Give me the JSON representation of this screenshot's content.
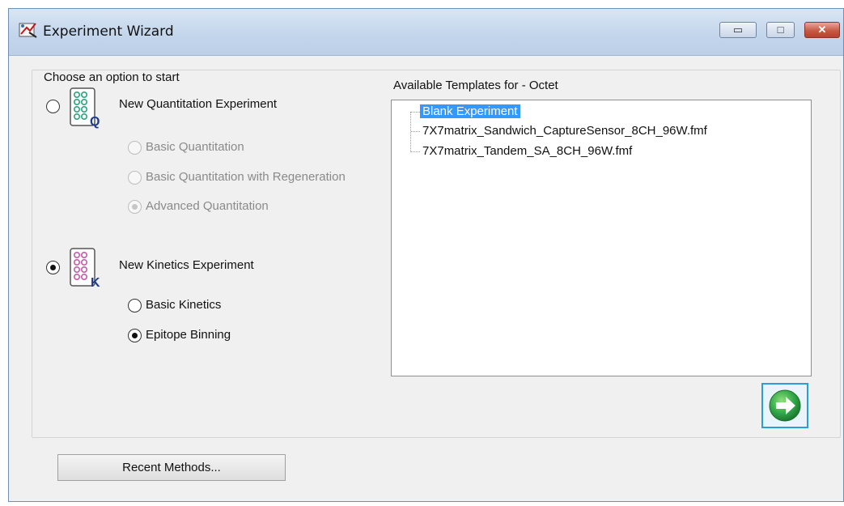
{
  "window": {
    "title": "Experiment Wizard"
  },
  "window_controls": {
    "minimize": "▭",
    "maximize": "□",
    "close": "✕"
  },
  "choose": {
    "legend": "Choose an option to start",
    "quantitation": {
      "label": "New Quantitation Experiment",
      "icon_letter": "Q",
      "selected": false,
      "options": [
        {
          "label": "Basic Quantitation",
          "enabled": false,
          "selected": false
        },
        {
          "label": "Basic Quantitation with Regeneration",
          "enabled": false,
          "selected": false
        },
        {
          "label": "Advanced Quantitation",
          "enabled": false,
          "selected": true
        }
      ]
    },
    "kinetics": {
      "label": "New Kinetics Experiment",
      "icon_letter": "K",
      "selected": true,
      "options": [
        {
          "label": "Basic Kinetics",
          "enabled": true,
          "selected": false
        },
        {
          "label": "Epitope Binning",
          "enabled": true,
          "selected": true
        }
      ]
    }
  },
  "templates": {
    "heading": "Available Templates for - Octet",
    "items": [
      {
        "label": "Blank Experiment",
        "selected": true
      },
      {
        "label": "7X7matrix_Sandwich_CaptureSensor_8CH_96W.fmf",
        "selected": false
      },
      {
        "label": "7X7matrix_Tandem_SA_8CH_96W.fmf",
        "selected": false
      }
    ]
  },
  "buttons": {
    "recent_methods": "Recent Methods..."
  },
  "colors": {
    "selection": "#3399ff",
    "go_arrow": "#2fa84f",
    "focus_border": "#2a9fd6"
  },
  "icons": [
    "experiment-wizard-icon",
    "quantitation-icon",
    "kinetics-icon",
    "go-arrow-icon"
  ]
}
